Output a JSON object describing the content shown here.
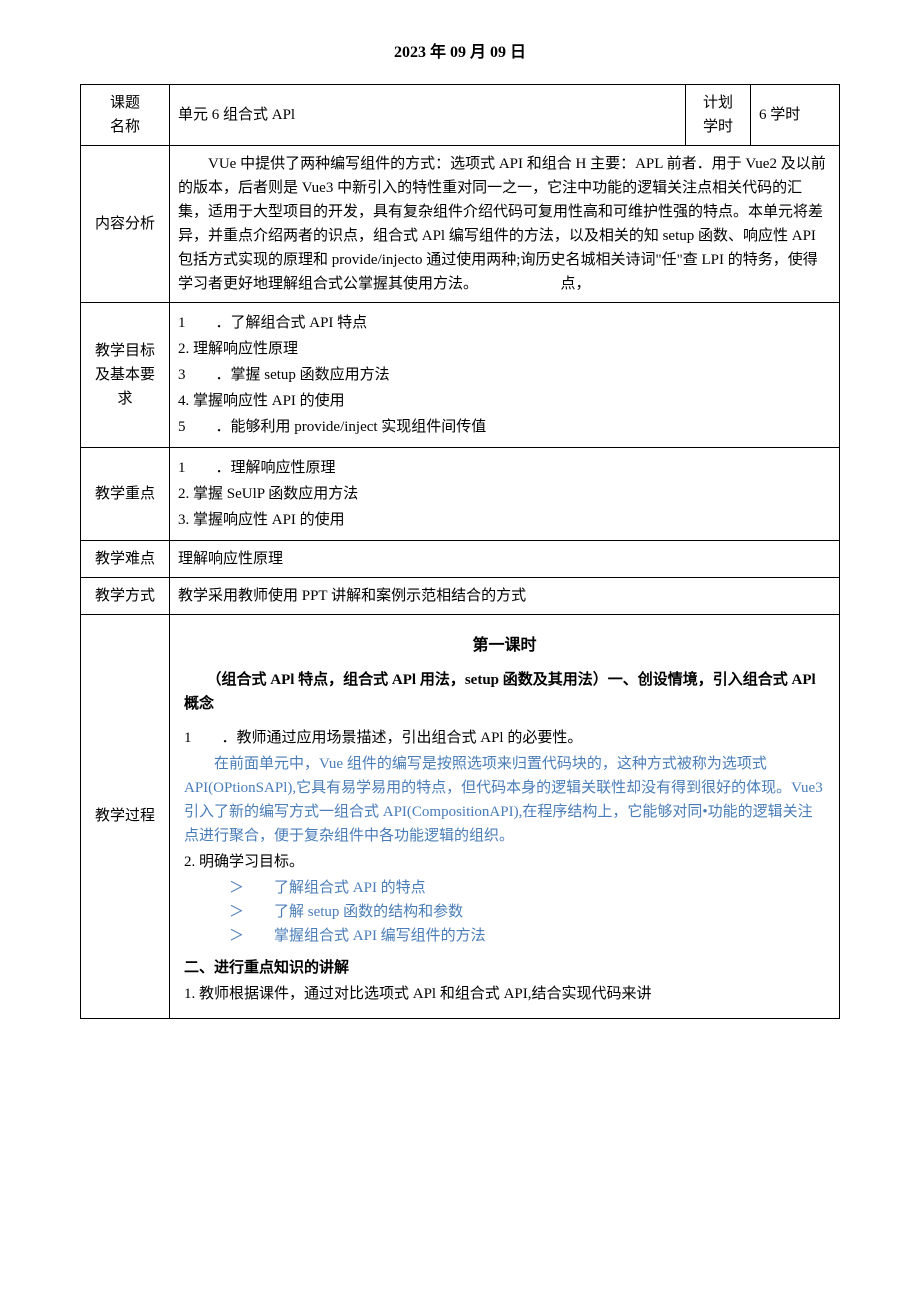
{
  "date": "2023 年 09 月 09 日",
  "rows": {
    "topic_label": "课题\n名称",
    "topic_value": "单元 6 组合式 APl",
    "plan_label": "计划\n学时",
    "plan_value": "6 学时",
    "content_label": "内容分析",
    "content_value": "　　VUe 中提供了两种编写组件的方式：选项式 API 和组合 H 主要：APL 前者．用于 Vue2 及以前的版本，后者则是 Vue3 中新引入的特性重对同一之一，它注中功能的逻辑关注点相关代码的汇集，适用于大型项目的开发，具有复杂组件介绍代码可复用性高和可维护性强的特点。本单元将差异，并重点介绍两者的识点，组合式 APl 编写组件的方法，以及相关的知 setup 函数、响应性 API 包括方式实现的原理和 provide/injecto 通过使用两种;询历史名城相关诗词\"任\"查 LPI 的特务，使得学习者更好地理解组合式公掌握其使用方法。　　　　　　点，",
    "goals_label": "教学目标及基本要求",
    "goals_1": "1　　．了解组合式 API 特点",
    "goals_2": "2. 理解响应性原理",
    "goals_3": "3　　．掌握 setup 函数应用方法",
    "goals_4": "4. 掌握响应性 API 的使用",
    "goals_5": "5　　．能够利用 provide/inject 实现组件间传值",
    "focus_label": "教学重点",
    "focus_1": "1　　．理解响应性原理",
    "focus_2": "2. 掌握 SeUlP 函数应用方法",
    "focus_3": "3. 掌握响应性 API 的使用",
    "diff_label": "教学难点",
    "diff_value": "理解响应性原理",
    "method_label": "教学方式",
    "method_value": "教学采用教师使用 PPT 讲解和案例示范相结合的方式",
    "process_label": "教学过程"
  },
  "process": {
    "title": "第一课时",
    "subtitle": "（组合式 APl 特点，组合式 APl 用法，setup 函数及其用法）一、创设情境，引入组合式 APl 概念",
    "p1": "1　　．教师通过应用场景描述，引出组合式 APl 的必要性。",
    "blue": "　　在前面单元中，Vue 组件的编写是按照选项来归置代码块的，这种方式被称为选项式 API(OPtionSAPl),它具有易学易用的特点，但代码本身的逻辑关联性却没有得到很好的体现。Vue3 引入了新的编写方式一组合式 API(CompositionAPI),在程序结构上，它能够对同•功能的逻辑关注点进行聚合，便于复杂组件中各功能逻辑的组织。",
    "p2": "2. 明确学习目标。",
    "b1": "了解组合式 API 的特点",
    "b2": "了解 setup 函数的结构和参数",
    "b3": "掌握组合式 API 编写组件的方法",
    "h2": "二、进行重点知识的讲解",
    "p3": "1. 教师根据课件，通过对比选项式 APl 和组合式 API,结合实现代码来讲"
  }
}
